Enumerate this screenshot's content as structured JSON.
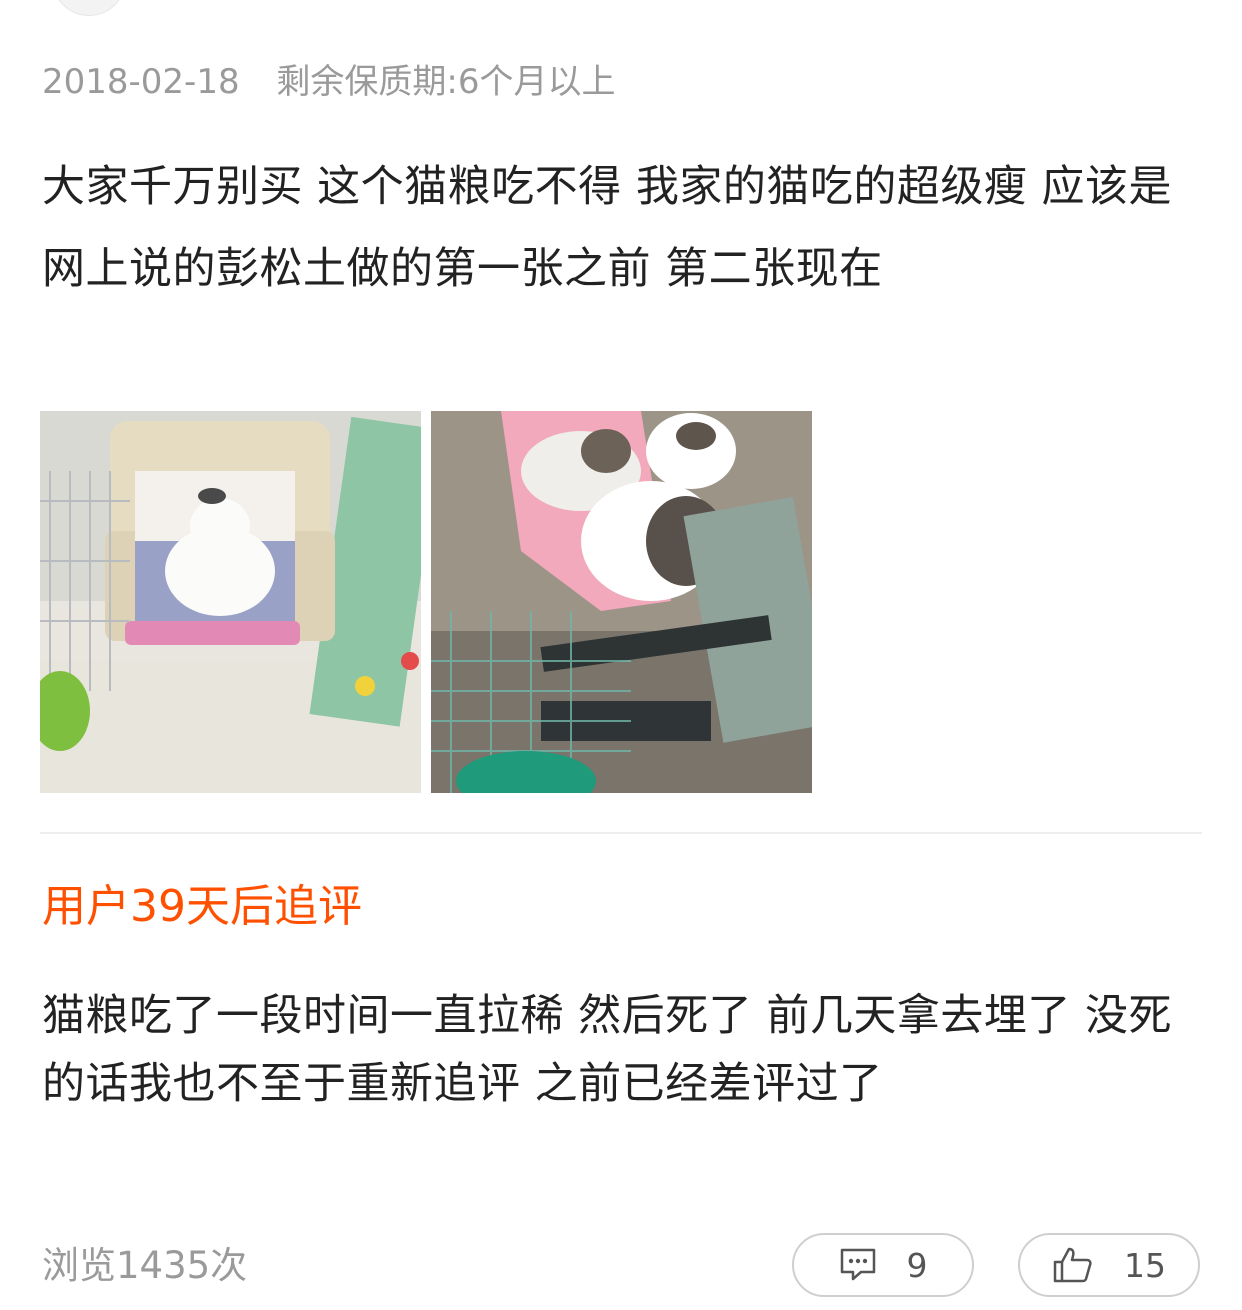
{
  "review": {
    "date": "2018-02-18",
    "shelf_life": "剩余保质期:6个月以上",
    "text": "大家千万别买  这个猫粮吃不得   我家的猫吃的超级瘦   应该是网上说的彭松土做的第一张之前  第二张现在",
    "photos": [
      {
        "name": "photo-cat-in-carrier",
        "icon": "cat-photo"
      },
      {
        "name": "photo-cats-in-cage",
        "icon": "cat-photo"
      }
    ]
  },
  "followup": {
    "title": "用户39天后追评",
    "text": "猫粮吃了一段时间一直拉稀  然后死了  前几天拿去埋了    没死的话我也不至于重新追评  之前已经差评过了"
  },
  "footer": {
    "views": "浏览1435次",
    "comment_count": "9",
    "like_count": "15",
    "comment_icon": "comment-bubble-icon",
    "like_icon": "thumbs-up-icon"
  },
  "colors": {
    "accent": "#ff5000",
    "meta_gray": "#9a9a9a",
    "text": "#222222"
  }
}
